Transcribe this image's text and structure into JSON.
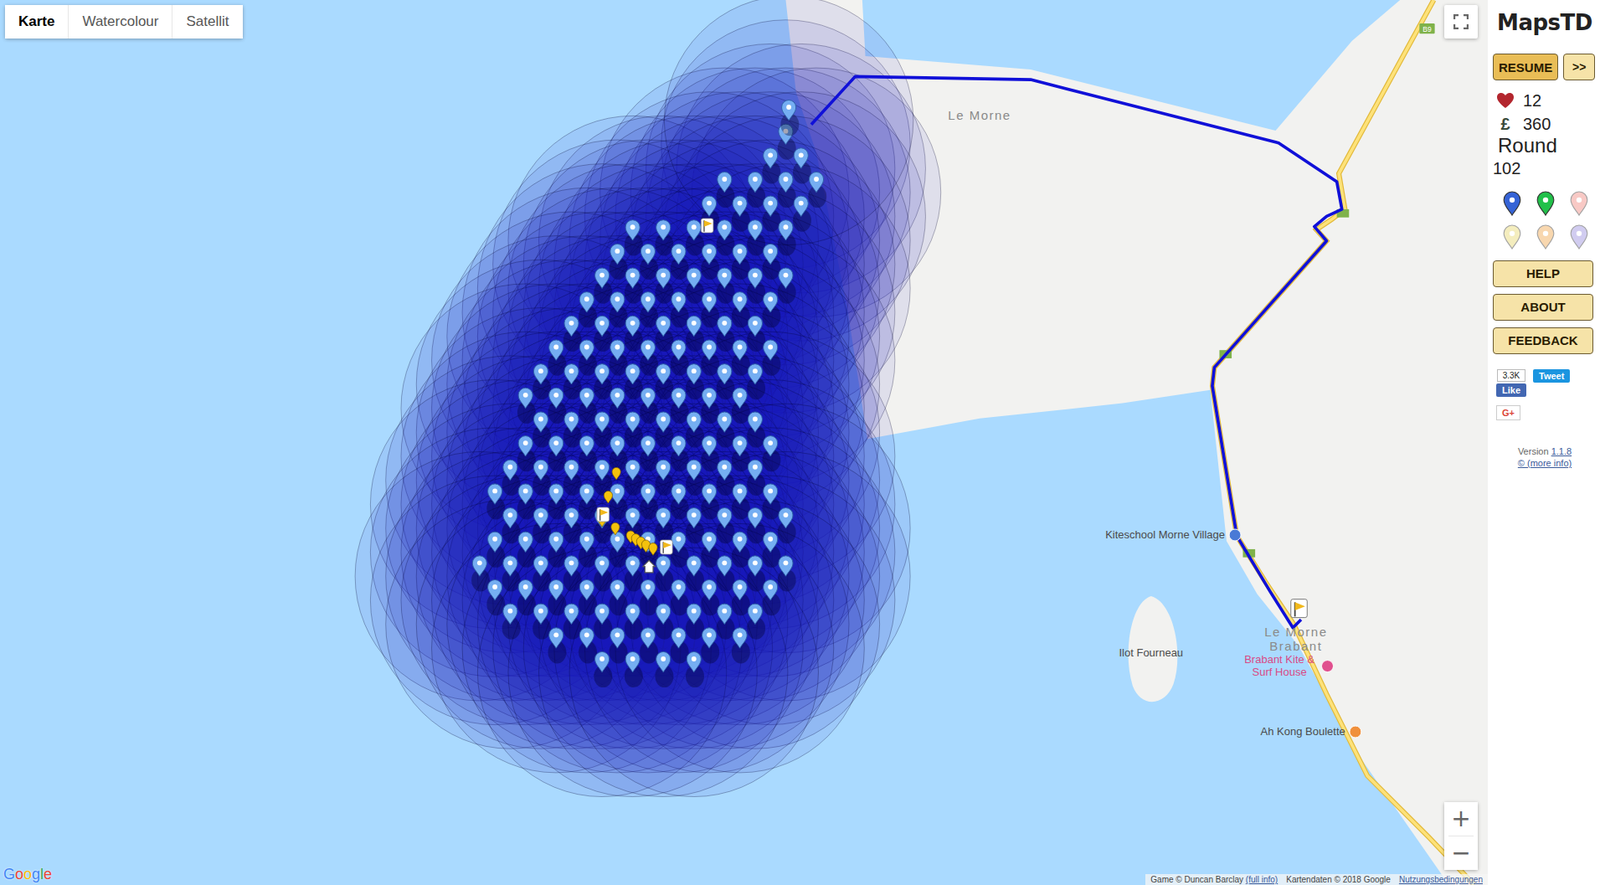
{
  "map_type": [
    {
      "label": "Karte",
      "selected": true
    },
    {
      "label": "Watercolour",
      "selected": false
    },
    {
      "label": "Satellit",
      "selected": false
    }
  ],
  "map_labels": [
    {
      "text": "Le Morne",
      "kind": "area"
    },
    {
      "text": "Kiteschool Morne Village",
      "kind": "poi",
      "color": "#4a7ad6"
    },
    {
      "text": "Ilot Fourneau",
      "kind": "island"
    },
    {
      "text": "Le Morne Brabant",
      "kind": "area"
    },
    {
      "text": "Brabant Kite & Surf House",
      "kind": "poi",
      "color": "#e0508e"
    },
    {
      "text": "Ah Kong Boulette",
      "kind": "poi",
      "color": "#f0903c"
    }
  ],
  "road_shield": "B9",
  "zoom": [
    "+",
    "−"
  ],
  "attribution": {
    "logo": "Google",
    "game": "Game © Duncan Barclay",
    "game_link": "(full info)",
    "map_data": "Kartendaten © 2018 Google",
    "terms": "Nutzungsbedingungen"
  },
  "sidebar": {
    "logo": "MapsTD",
    "controls": [
      "RESUME",
      ">>"
    ],
    "lives": "12",
    "currency": "£",
    "money": "360",
    "round_label": "Round",
    "round": "102",
    "towers": [
      {
        "color": "#3563d6",
        "disabled": false
      },
      {
        "color": "#22c04a",
        "disabled": false
      },
      {
        "color": "#f08a80",
        "disabled": true
      },
      {
        "color": "#e8d870",
        "disabled": true
      },
      {
        "color": "#f0a850",
        "disabled": true
      },
      {
        "color": "#9a90e0",
        "disabled": true
      }
    ],
    "menu": [
      "HELP",
      "ABOUT",
      "FEEDBACK"
    ],
    "social": {
      "like_count": "3.3K",
      "like": "Like",
      "tweet": "Tweet",
      "gplus": "G+"
    },
    "version_label": "Version",
    "version": "1.1.8",
    "more_info": "© (more info)"
  }
}
